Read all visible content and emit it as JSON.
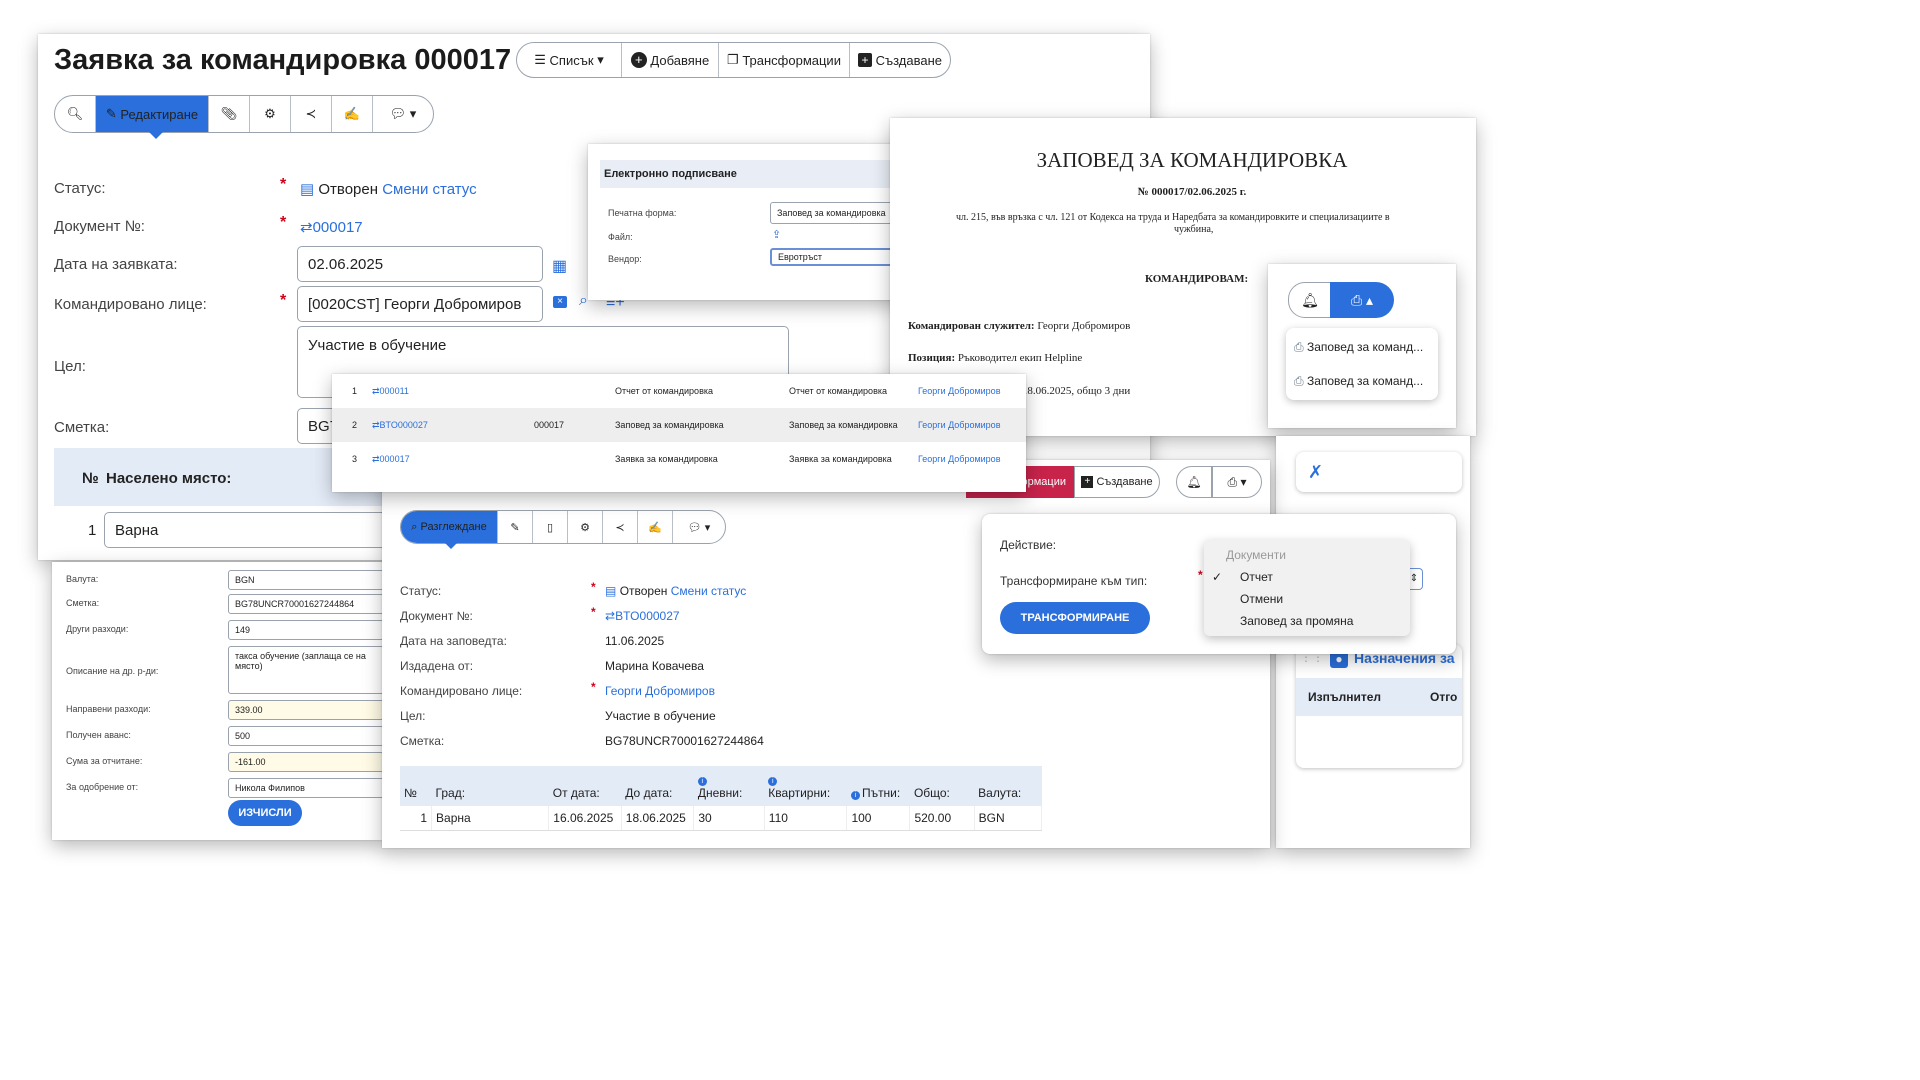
{
  "main": {
    "title": "Заявка за командировка 000017",
    "top_toolbar": [
      "Списък",
      "Добавяне",
      "Трансформации",
      "Създаване"
    ],
    "edit_label": "Редактиране",
    "fields": {
      "status_label": "Статус:",
      "status_value": "Отворен",
      "status_link": "Смени статус",
      "doc_label": "Документ №:",
      "doc_value": "000017",
      "date_label": "Дата на заявката:",
      "date_value": "02.06.2025",
      "person_label": "Командировано лице:",
      "person_value": "[0020CST] Георги Добромиров",
      "goal_label": "Цел:",
      "goal_value": "Участие в обучение",
      "account_label": "Сметка:",
      "account_value": "BG7"
    },
    "table": {
      "col_no": "№",
      "col_place": "Населено място:",
      "row_no": "1",
      "row_place": "Варна"
    }
  },
  "bottom_left": {
    "rows": [
      {
        "label": "Валута:",
        "value": "BGN"
      },
      {
        "label": "Сметка:",
        "value": "BG78UNCR70001627244864"
      },
      {
        "label": "Други разходи:",
        "value": "149"
      },
      {
        "label": "Описание на др. р-ди:",
        "value": "такса обучение (заплаща се на място)"
      },
      {
        "label": "Направени разходи:",
        "value": "339.00"
      },
      {
        "label": "Получен аванс:",
        "value": "500"
      },
      {
        "label": "Сума за отчитане:",
        "value": "-161.00"
      },
      {
        "label": "За одобрение от:",
        "value": "Никола Филипов"
      }
    ],
    "button": "ИЗЧИСЛИ"
  },
  "esign": {
    "header": "Електронно подписване",
    "form_label": "Печатна форма:",
    "form_value": "Заповед за командировка",
    "file_label": "Файл:",
    "vendor_label": "Вендор:",
    "vendor_value": "Евротръст"
  },
  "related": {
    "rows": [
      {
        "n": "1",
        "doc": "000011",
        "num": "",
        "type": "Отчет от командировка",
        "type2": "Отчет от командировка",
        "person": "Георги Добромиров"
      },
      {
        "n": "2",
        "doc": "BTO000027",
        "num": "000017",
        "type": "Заповед за командировка",
        "type2": "Заповед за командировка",
        "person": "Георги Добромиров"
      },
      {
        "n": "3",
        "doc": "000017",
        "num": "",
        "type": "Заявка за командировка",
        "type2": "Заявка за командировка",
        "person": "Георги Добромиров"
      }
    ]
  },
  "order_doc": {
    "title": "ЗАПОВЕД ЗА КОМАНДИРОВКА",
    "number": "№ 000017/02.06.2025 г.",
    "legal": "чл. 215, във връзка с чл. 121 от Кодекса на труда и Наредбата за командировките и специализациите в",
    "legal2": "чужбина,",
    "command": "КОМАНДИРОВАМ:",
    "employee_label": "Командирован служител:",
    "employee": "Георги Добромиров",
    "position_label": "Позиция:",
    "position": "Ръководител екип Helpline",
    "period": "до 18.06.2025, общо 3 дни"
  },
  "print_menu": {
    "items": [
      "Заповед за команд...",
      "Заповед за команд..."
    ]
  },
  "view": {
    "partial_buttons": [
      "ормации",
      "Създаване"
    ],
    "view_label": "Разглеждане",
    "fields": [
      {
        "label": "Статус:",
        "value": "Отворен",
        "link": "Смени статус"
      },
      {
        "label": "Документ №:",
        "value": "BTO000027"
      },
      {
        "label": "Дата на заповедта:",
        "value": "11.06.2025"
      },
      {
        "label": "Издадена от:",
        "value": "Марина Ковачева"
      },
      {
        "label": "Командировано лице:",
        "value": "Георги Добромиров"
      },
      {
        "label": "Цел:",
        "value": "Участие в обучение"
      },
      {
        "label": "Сметка:",
        "value": "BG78UNCR70001627244864"
      }
    ],
    "table": {
      "headers": [
        "№",
        "Град:",
        "От дата:",
        "До дата:",
        "Дневни:",
        "Квартирни:",
        "Пътни:",
        "Общо:",
        "Валута:"
      ],
      "row": [
        "1",
        "Варна",
        "16.06.2025",
        "18.06.2025",
        "30",
        "110",
        "100",
        "520.00",
        "BGN"
      ]
    }
  },
  "transform": {
    "action_label": "Действие:",
    "type_label": "Трансформиране към тип:",
    "button": "ТРАНСФОРМИРАНЕ",
    "dropdown_header": "Документи",
    "options": [
      "Отчет",
      "Отмени",
      "Заповед за промяна"
    ]
  },
  "right_panel": {
    "assign_title": "Назначения за",
    "col1": "Изпълнител",
    "col2": "Отго"
  }
}
